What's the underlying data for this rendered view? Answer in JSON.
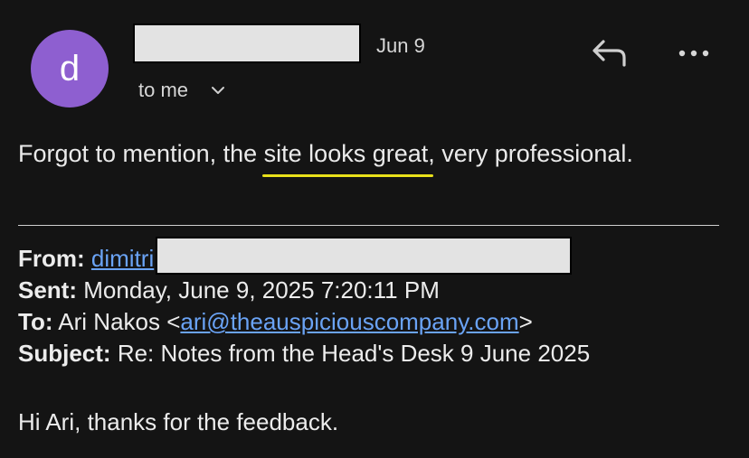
{
  "header": {
    "avatar_letter": "d",
    "date": "Jun 9",
    "recipient_label": "to me",
    "avatar_color": "#8e5fd0"
  },
  "message": {
    "prefix": "Forgot to mention, the ",
    "highlight": "site looks great",
    "suffix": ", very professional.",
    "highlight_color": "#e8e01a"
  },
  "quoted": {
    "from_label": "From:",
    "from_name": "dimitri",
    "sent_label": "Sent:",
    "sent_value": "Monday, June 9, 2025 7:20:11 PM",
    "to_label": "To:",
    "to_name": "Ari Nakos <",
    "to_email": "ari@theauspiciouscompany.com",
    "to_close": ">",
    "subject_label": "Subject:",
    "subject_value": "Re: Notes from the Head's Desk 9 June 2025",
    "link_color": "#6aa3f5"
  },
  "greeting": "Hi Ari, thanks for the feedback.",
  "icons": {
    "reply": "reply-icon",
    "more": "more-icon",
    "expand": "chevron-down-icon"
  }
}
